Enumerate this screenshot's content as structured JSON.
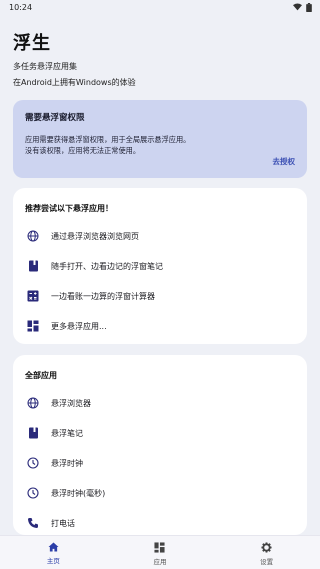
{
  "status_bar": {
    "time": "10:24"
  },
  "header": {
    "title": "浮生",
    "subtitle": "多任务悬浮应用集",
    "description": "在Android上拥有Windows的体验"
  },
  "permission_card": {
    "title": "需要悬浮窗权限",
    "text_line1": "应用需要获得悬浮窗权限，用于全局展示悬浮应用。",
    "text_line2": "没有该权限，应用将无法正常使用。",
    "action": "去授权"
  },
  "recommend": {
    "heading": "推荐尝试以下悬浮应用！",
    "items": [
      {
        "label": "通过悬浮浏览器浏览网页",
        "icon": "globe-icon"
      },
      {
        "label": "随手打开、边看边记的浮窗笔记",
        "icon": "notebook-icon"
      },
      {
        "label": "一边看账一边算的浮窗计算器",
        "icon": "calculator-icon"
      },
      {
        "label": "更多悬浮应用...",
        "icon": "apps-grid-icon"
      }
    ]
  },
  "all_apps": {
    "heading": "全部应用",
    "items": [
      {
        "label": "悬浮浏览器",
        "icon": "globe-icon"
      },
      {
        "label": "悬浮笔记",
        "icon": "notebook-icon"
      },
      {
        "label": "悬浮时钟",
        "icon": "clock-icon"
      },
      {
        "label": "悬浮时钟(毫秒)",
        "icon": "clock-icon"
      },
      {
        "label": "打电话",
        "icon": "phone-icon"
      }
    ]
  },
  "bottom_nav": {
    "items": [
      {
        "label": "主页",
        "icon": "home-icon",
        "active": true
      },
      {
        "label": "应用",
        "icon": "apps-grid-icon",
        "active": false
      },
      {
        "label": "设置",
        "icon": "gear-icon",
        "active": false
      }
    ]
  },
  "colors": {
    "accent": "#3b4fb3",
    "icon": "#2a2a7a",
    "permission_bg": "#cdd4f0",
    "background": "#eef0f6"
  }
}
